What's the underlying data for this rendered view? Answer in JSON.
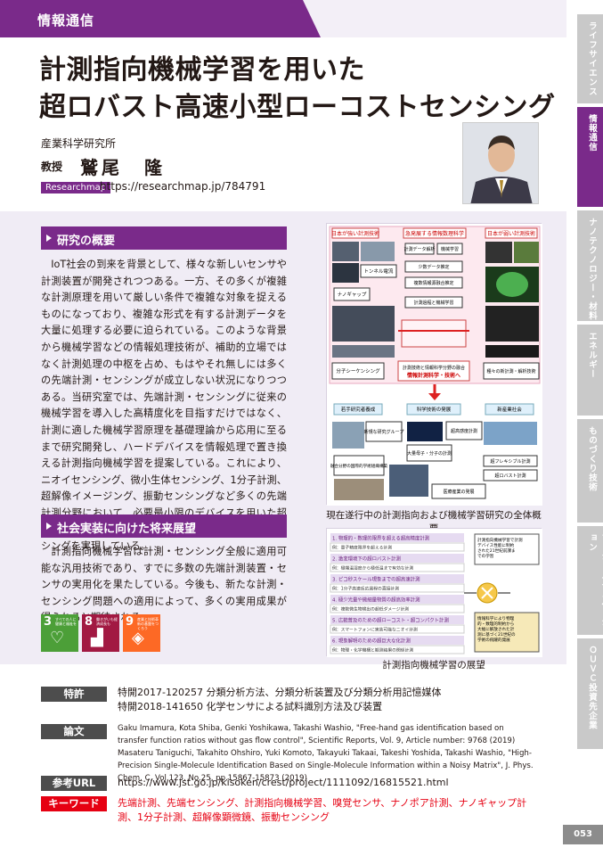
{
  "category": "情報通信",
  "title_line1": "計測指向機械学習を用いた",
  "title_line2": "超ロバスト高速小型ローコストセンシング",
  "org": "産業科学研究所",
  "role": "教授",
  "name": "鷲尾　隆",
  "researchmap": {
    "badge": "Researchmap",
    "url": "https://researchmap.jp/784791"
  },
  "sections": {
    "overview": {
      "heading": "研究の概要",
      "body": "IoT社会の到来を背景として、様々な新しいセンサや計測装置が開発されつつある。一方、その多くが複雑な計測原理を用いて厳しい条件で複雑な対象を捉えるものになっており、複雑な形式を有する計測データを大量に処理する必要に迫られている。このような背景から機械学習などの情報処理技術が、補助的立場ではなく計測処理の中枢を占め、もはやそれ無しには多くの先端計測・センシングが成立しない状況になりつつある。当研究室では、先端計測・センシングに従来の機械学習を導入した高精度化を目指すだけではなく、計測に適した機械学習原理を基礎理論から応用に至るまで研究開発し、ハードデバイスを情報処理で置き換える計測指向機械学習を提案している。これにより、ニオイセンシング、微小生体センシング、1分子計測、超解像イメージング、振動センシングなど多くの先端計測分野において、必要最小限のデバイスを用いた超ロバスト、超高速、超小型、超ローコスト計測・センシングを実現している。"
    },
    "future": {
      "heading": "社会実装に向けた将来展望",
      "body": "計測指向機械学習は計測・センシング全般に適用可能な汎用技術であり、すでに多数の先端計測装置・センサの実用化を果たしている。今後も、新たな計測・センシング問題への適用によって、多くの実用成果が得られると期待される。"
    }
  },
  "sdgs": [
    {
      "num": "3",
      "text": "すべての人に健康と福祉を",
      "color": "#4c9f38",
      "icon": "heartbeat-icon"
    },
    {
      "num": "8",
      "text": "働きがいも経済成長も",
      "color": "#a21942",
      "icon": "growth-chart-icon"
    },
    {
      "num": "9",
      "text": "産業と技術革新の基盤をつくろう",
      "color": "#fd6925",
      "icon": "cubes-icon"
    }
  ],
  "figure1": {
    "caption": "現在遂行中の計測指向および機械学習研究の全体概要",
    "boxes": [
      "日本が強い計測技術",
      "急発展する情報数理科学",
      "日本が弱い計測技術",
      "トンネル電流",
      "ナノギャップ",
      "計測データ解析",
      "機械学習",
      "少数データ推定",
      "複数情報源融合推定",
      "計測過程と機械学習",
      "分子シーケンシング",
      "計測技術と情報科学分野の融合",
      "情報計測科学・技術へ",
      "種々の新計測・解析技術",
      "若手研究者養成",
      "科学技術の発展",
      "新産業社会",
      "新規な研究グループ",
      "超高感度計測",
      "大量母子・分子の計測",
      "融合分野の国際的学術組織構築",
      "超フレキシブル計測",
      "超ロバスト計測",
      "医療産業の発展"
    ]
  },
  "figure2": {
    "caption": "計測指向機械学習の展望",
    "items": [
      {
        "title": "1. 物理的・数理的限界を超える超高精度計測",
        "ex": "例：量子精度限界を超える計測"
      },
      {
        "title": "2. 激変環境下の超ロバスト計測",
        "ex": "例：極端温湿度から極低温まで有効な計測"
      },
      {
        "title": "3. ピコ秒スケール現象までの超高速計測",
        "ex": "例：1分子高速反応過程の直接計測"
      },
      {
        "title": "4. 極少光量や微細量物質の超高効率計測",
        "ex": "例：複数微生物検出の超低ダメージ計測"
      },
      {
        "title": "5. 広範普及のための超ローコスト・超コンパクト計測",
        "ex": "例：スマートフォンに実装可能なニオイ計測"
      },
      {
        "title": "6. 現象解明のための超巨大な化計測",
        "ex": "例：物理・化学機構と観測結果の関係計測"
      }
    ],
    "side_top": "計測指向機械学習で計測デバイス性能に制約された21世紀前課までの学習",
    "side_bottom": "情報科学により物理的・数理的制約から大幅に解放された計測に基づく21世紀の学術の飛躍的発展"
  },
  "info": {
    "patent": {
      "label": "特許",
      "lines": [
        "特開2017-120257 分類分析方法、分類分析装置及び分類分析用記憶媒体",
        "特開2018-141650 化学センサによる試料識別方法及び装置"
      ]
    },
    "papers": {
      "label": "論文",
      "lines": [
        "Gaku Imamura, Kota Shiba, Genki Yoshikawa, Takashi Washio, \"Free-hand gas identification based on transfer function ratios without gas flow control\", Scientific Reports, Vol. 9, Article number: 9768 (2019)",
        "Masateru Taniguchi, Takahito Ohshiro, Yuki Komoto, Takayuki Takaai, Takeshi Yoshida, Takashi Washio, \"High-Precision Single-Molecule Identification Based on Single-Molecule Information within a Noisy Matrix\", J. Phys. Chem. C, Vol.123, No.25, pp.15867-15873 (2019)"
      ]
    },
    "url": {
      "label": "参考URL",
      "text": "https://www.jst.go.jp/kisoken/crest/project/1111092/16815521.html"
    },
    "keywords": {
      "label": "キーワード",
      "text": "先端計測、先端センシング、計測指向機械学習、嗅覚センサ、ナノポア計測、ナノギャップ計測、1分子計測、超解像顕微鏡、振動センシング"
    }
  },
  "side_tabs": [
    "ライフサイエンス",
    "情報通信",
    "ナノテクノロジー・材料",
    "エネルギー",
    "ものづくり技術",
    "ソーシャルイノベーション",
    "ＯＵＶＣ投資先企業"
  ],
  "page_number": "053"
}
